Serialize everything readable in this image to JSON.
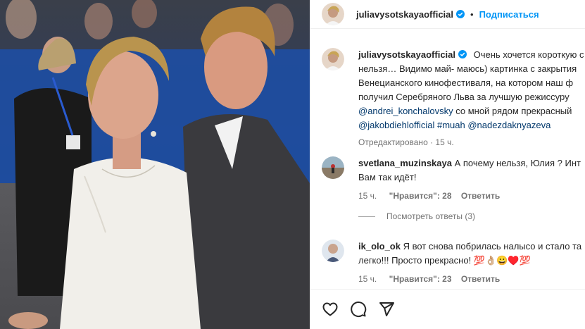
{
  "header": {
    "username": "juliavysotskaya​official",
    "separator": "•",
    "follow_label": "Подписаться"
  },
  "caption": {
    "username": "juliavysotskayaofficial",
    "line1": "Очень хочется короткую с",
    "line2": "нельзя… Видимо май- маюсь) картинка с закрытия",
    "line3": "Венецианского кинофестиваля, на котором наш ф",
    "line4": "получил Серебряного Льва за лучшую режиссуру",
    "mention1": "@andrei_konchalovsky",
    "line5_rest": " со мной рядом прекрасный",
    "mention2": "@jakobdiehlofficial",
    "hashtag": " #muah ",
    "mention3": "@nadezdaknyazeva",
    "meta": "Отредактировано · 15 ч."
  },
  "comment1": {
    "username": "svetlana_muzinskaya",
    "text1": "А почему нельзя, Юлия ? Инт",
    "text2": "Вам так идёт!",
    "time": "15 ч.",
    "likes": "\"Нравится\": 28",
    "reply": "Ответить",
    "view_replies": "Посмотреть ответы (3)"
  },
  "comment2": {
    "username": "ik_olo_ok",
    "text1": "Я вот снова побрилась налысо и стало та",
    "text2": "легко!!! Просто прекрасно! 💯👌🏼😀♥️💯",
    "time": "15 ч.",
    "likes": "\"Нравится\": 23",
    "reply": "Ответить"
  },
  "actions": {
    "like_icon": "heart-icon",
    "comment_icon": "comment-icon",
    "share_icon": "send-icon"
  },
  "colors": {
    "link": "#0095f6",
    "mention": "#00376b",
    "muted": "#737373"
  }
}
